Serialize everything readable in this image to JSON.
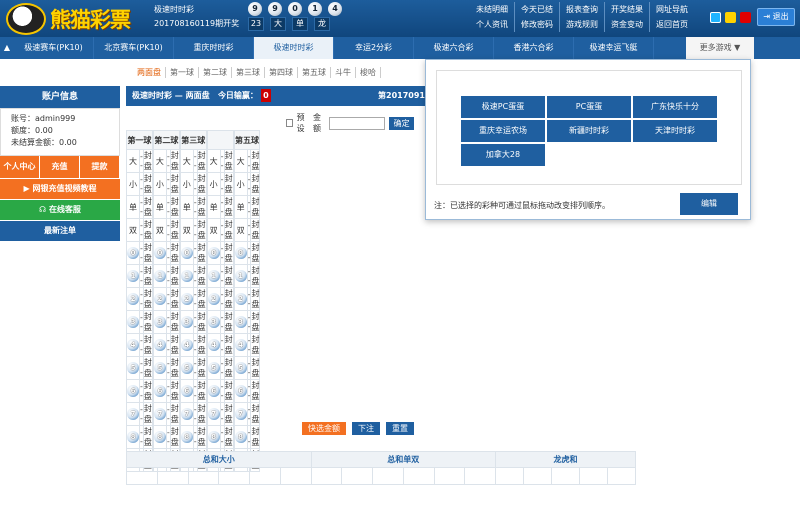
{
  "header": {
    "logo_text": "熊猫彩票",
    "lottery_name": "极速时时彩",
    "period_line": "201708160119期开奖",
    "balls": [
      "9",
      "9",
      "0",
      "1",
      "4"
    ],
    "attrs": [
      "23",
      "大",
      "单",
      "龙"
    ],
    "links_row1": [
      "未结明细",
      "今天已结",
      "报表查询",
      "开奖结果",
      "网址导航"
    ],
    "links_row2": [
      "个人资讯",
      "修改密码",
      "游戏规则",
      "资金变动",
      "返回首页"
    ],
    "logout": "退出",
    "skin_colors": [
      "#1fb4ff",
      "#ffd200",
      "#e00000"
    ]
  },
  "nav": {
    "tabs": [
      "极速赛车(PK10)",
      "北京赛车(PK10)",
      "重庆时时彩",
      "极速时时彩",
      "幸运2分彩",
      "极速六合彩",
      "香港六合彩",
      "极速幸运飞艇"
    ],
    "more": "更多游戏 ▼"
  },
  "subtabs": [
    "两面盘",
    "第一球",
    "第二球",
    "第三球",
    "第四球",
    "第五球",
    "斗牛",
    "梭哈"
  ],
  "sidebar": {
    "title": "账户信息",
    "account": "账号：admin999",
    "credit": "额度：0.00",
    "unsettled": "未结算金额：0.00",
    "btns": [
      "个人中心",
      "充值",
      "提款"
    ],
    "tutorial": "网银充值视频教程",
    "service": "在线客服",
    "latest": "最新注单"
  },
  "main": {
    "title": "极速时时彩 — 两面盘",
    "today_label": "今日输赢：",
    "today_value": "0",
    "draw_no": "第20170914",
    "preset": "预设",
    "amount_label": "金额",
    "ok": "确定",
    "ball_headers": [
      "第一球",
      "第二球",
      "第三球",
      "",
      "第五球"
    ],
    "bs_labels": [
      "大",
      "小",
      "单",
      "双"
    ],
    "odds": "--",
    "bet": "封盘",
    "quick_amount": "快选金额",
    "place_bet": "下注",
    "reset": "重置"
  },
  "summary_headers": [
    "总和大小",
    "总和单双",
    "龙虎和"
  ],
  "popup": {
    "games": [
      "极速PC蛋蛋",
      "PC蛋蛋",
      "广东快乐十分",
      "重庆幸运农场",
      "新疆时时彩",
      "天津时时彩",
      "加拿大28"
    ],
    "note": "注：已选择的彩种可通过鼠标拖动改变排列顺序。",
    "edit": "编辑"
  },
  "colors": {
    "blue": "#1f5fa0",
    "orange": "#f37021",
    "green": "#2aa846"
  }
}
